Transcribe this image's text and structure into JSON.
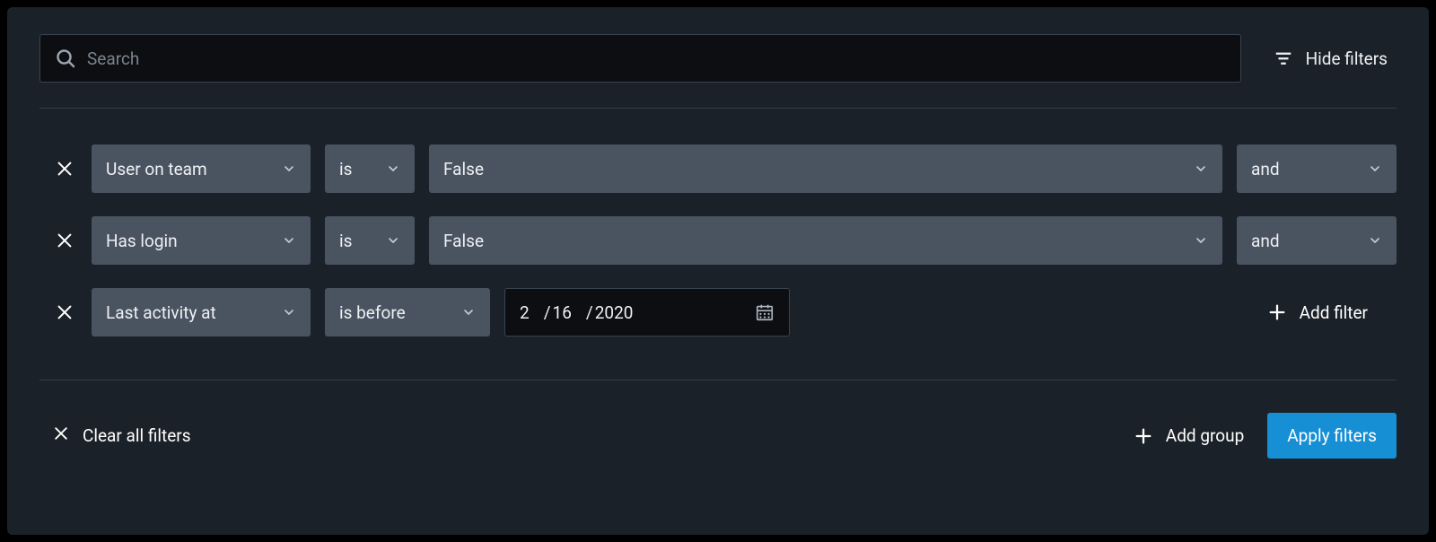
{
  "search": {
    "placeholder": "Search"
  },
  "hide_filters_label": "Hide filters",
  "filters": [
    {
      "field": "User on team",
      "operator": "is",
      "value": "False",
      "join": "and"
    },
    {
      "field": "Has login",
      "operator": "is",
      "value": "False",
      "join": "and"
    },
    {
      "field": "Last activity at",
      "operator": "is before",
      "date": {
        "month": "2",
        "day": "16",
        "year": "2020"
      }
    }
  ],
  "add_filter_label": "Add filter",
  "clear_all_label": "Clear all filters",
  "add_group_label": "Add group",
  "apply_label": "Apply filters"
}
